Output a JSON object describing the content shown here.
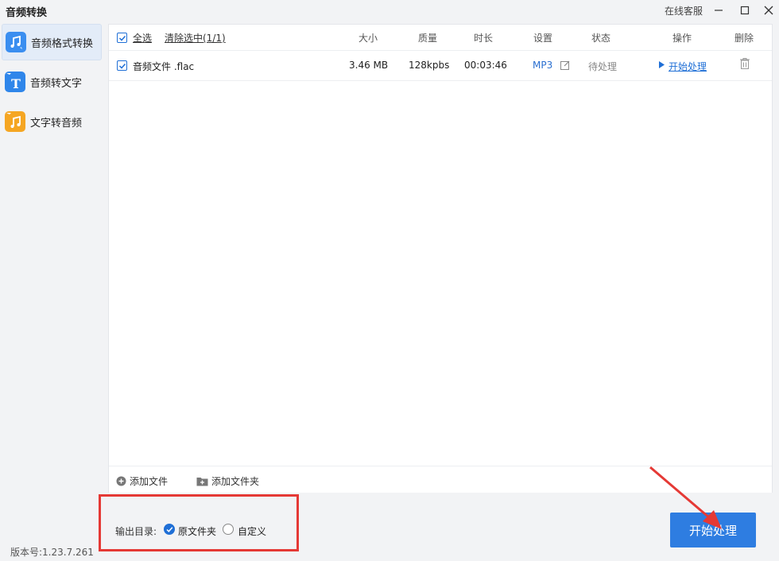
{
  "window": {
    "title": "音频转换",
    "support": "在线客服"
  },
  "sidebar": {
    "items": [
      {
        "label": "音频格式转换",
        "icon": "music-convert-icon",
        "active": true
      },
      {
        "label": "音频转文字",
        "icon": "text-t-icon",
        "active": false
      },
      {
        "label": "文字转音频",
        "icon": "music-note-icon",
        "active": false
      }
    ],
    "version": "版本号:1.23.7.261"
  },
  "list": {
    "select_all": "全选",
    "clear_selected": "清除选中(1/1)",
    "columns": {
      "size": "大小",
      "quality": "质量",
      "duration": "时长",
      "settings": "设置",
      "status": "状态",
      "action": "操作",
      "delete": "删除"
    },
    "rows": [
      {
        "checked": true,
        "name": "音频文件 .flac",
        "size": "3.46 MB",
        "quality": "128kpbs",
        "duration": "00:03:46",
        "format": "MP3",
        "status": "待处理",
        "action": "开始处理"
      }
    ]
  },
  "footer": {
    "add_file": "添加文件",
    "add_folder": "添加文件夹"
  },
  "output": {
    "label": "输出目录:",
    "option_original": "原文件夹",
    "option_custom": "自定义",
    "selected": "原文件夹"
  },
  "start_button": "开始处理",
  "colors": {
    "accent": "#2e7de1",
    "highlight": "#e53935"
  }
}
